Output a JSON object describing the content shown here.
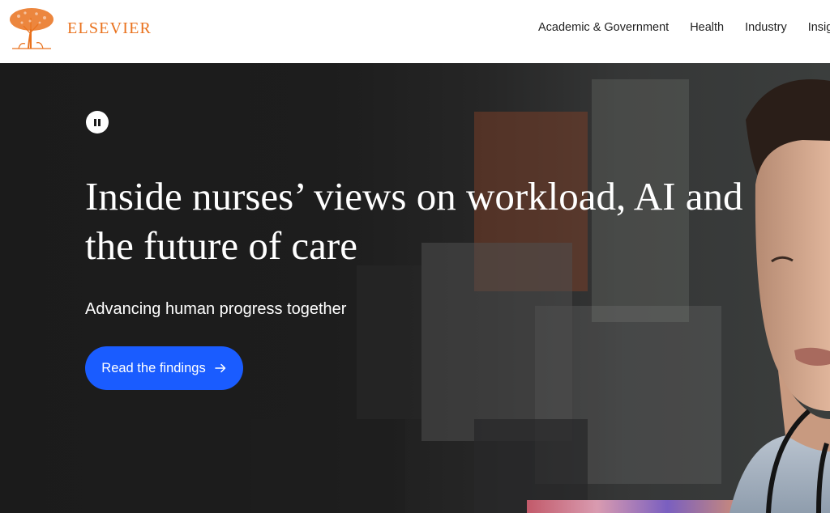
{
  "brand": {
    "name": "ELSEVIER",
    "logo_icon": "elsevier-tree-logo",
    "color": "#e9711c"
  },
  "nav": {
    "items": [
      {
        "label": "Academic & Government"
      },
      {
        "label": "Health"
      },
      {
        "label": "Industry"
      },
      {
        "label": "Insights"
      }
    ]
  },
  "hero": {
    "pause_icon": "pause-icon",
    "headline": "Inside nurses’ views on workload, AI and the future of care",
    "subheadline": "Advancing human progress together",
    "cta": {
      "label": "Read the findings",
      "icon": "arrow-right-icon",
      "color": "#1a5cff"
    }
  }
}
